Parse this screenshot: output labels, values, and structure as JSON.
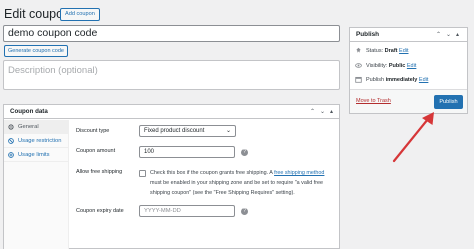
{
  "page": {
    "title": "Edit coupon",
    "add_button": "Add coupon",
    "coupon_code": "demo coupon code",
    "generate_button": "Generate coupon code",
    "description_placeholder": "Description (optional)"
  },
  "coupon_data": {
    "title": "Coupon data",
    "tabs": [
      {
        "label": "General",
        "icon": "gear-icon",
        "active": true
      },
      {
        "label": "Usage restriction",
        "icon": "restriction-icon",
        "active": false
      },
      {
        "label": "Usage limits",
        "icon": "plus-icon",
        "active": false
      }
    ],
    "general": {
      "discount_type_label": "Discount type",
      "discount_type_value": "Fixed product discount",
      "amount_label": "Coupon amount",
      "amount_value": "100",
      "free_shipping_label": "Allow free shipping",
      "free_shipping_text_before": "Check this box if the coupon grants free shipping. A ",
      "free_shipping_link": "free shipping method",
      "free_shipping_text_after": " must be enabled in your shipping zone and be set to require \"a valid free shipping coupon\" (see the \"Free Shipping Requires\" setting).",
      "expiry_label": "Coupon expiry date",
      "expiry_placeholder": "YYYY-MM-DD"
    }
  },
  "publish": {
    "title": "Publish",
    "status_label": "Status: ",
    "status_value": "Draft",
    "visibility_label": "Visibility: ",
    "visibility_value": "Public",
    "publish_label": "Publish ",
    "publish_value": "immediately",
    "edit_link": "Edit",
    "move_to_trash": "Move to Trash",
    "publish_button": "Publish"
  },
  "colors": {
    "accent": "#2271b1",
    "arrow": "#d63638",
    "trash": "#b32d2e",
    "background": "#f0f0f1"
  }
}
